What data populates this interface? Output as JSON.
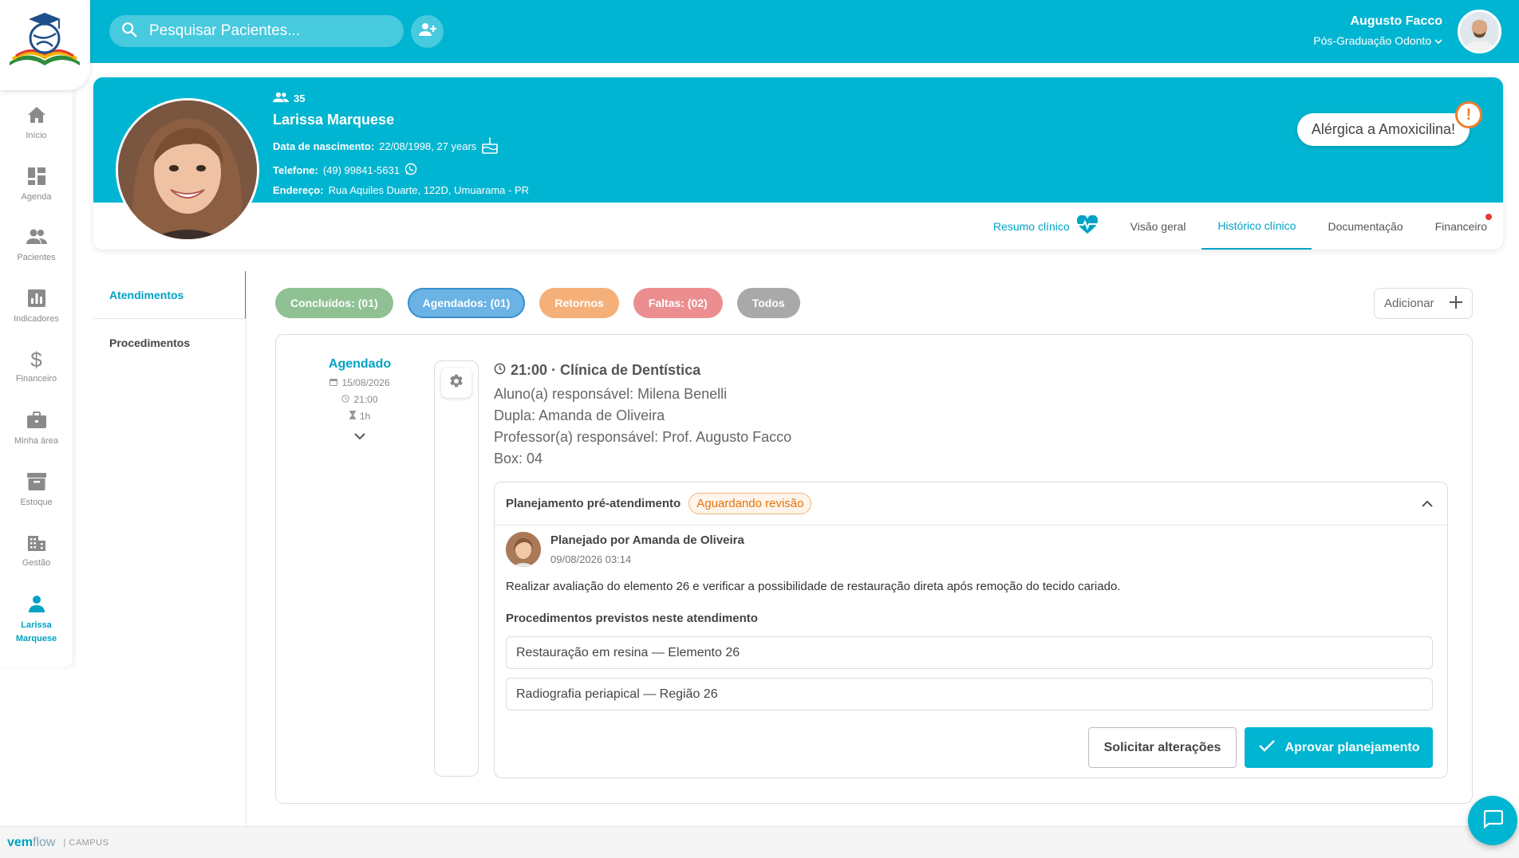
{
  "header": {
    "search_placeholder": "Pesquisar Pacientes...",
    "user_name": "Augusto Facco",
    "user_role": "Pós-Graduação Odonto"
  },
  "sidebar": {
    "items": [
      {
        "label": "Início"
      },
      {
        "label": "Agenda"
      },
      {
        "label": "Pacientes"
      },
      {
        "label": "Indicadores"
      },
      {
        "label": "Financeiro"
      },
      {
        "label": "Minha área"
      },
      {
        "label": "Estoque"
      },
      {
        "label": "Gestão"
      },
      {
        "label": "Larissa Marquese"
      }
    ]
  },
  "patient": {
    "count": "35",
    "name": "Larissa Marquese",
    "birth_label": "Data de nascimento:",
    "birth_value": "22/08/1998, 27 years",
    "phone_label": "Telefone:",
    "phone_value": "(49) 99841-5631",
    "address_label": "Endereço:",
    "address_value": "Rua Aquiles Duarte, 122D, Umuarama - PR",
    "allergy": "Alérgica a Amoxicilina!",
    "allergy_mark": "!"
  },
  "tabs": [
    {
      "label": "Resumo clínico"
    },
    {
      "label": "Visão geral"
    },
    {
      "label": "Histórico clínico"
    },
    {
      "label": "Documentação"
    },
    {
      "label": "Financeiro"
    }
  ],
  "subnav": [
    {
      "label": "Atendimentos"
    },
    {
      "label": "Procedimentos"
    }
  ],
  "filters": [
    {
      "label": "Concluídos: (01)"
    },
    {
      "label": "Agendados: (01)"
    },
    {
      "label": "Retornos"
    },
    {
      "label": "Faltas: (02)"
    },
    {
      "label": "Todos"
    }
  ],
  "add_label": "Adicionar",
  "appointment": {
    "status": "Agendado",
    "date": "15/08/2026",
    "time": "21:00",
    "duration": "1h",
    "title": "21:00 · Clínica de Dentística",
    "student": "Aluno(a) responsável: Milena Benelli",
    "pair": "Dupla: Amanda de Oliveira",
    "professor": "Professor(a) responsável: Prof. Augusto Facco",
    "box": "Box: 04"
  },
  "planning": {
    "title": "Planejamento pré-atendimento",
    "badge": "Aguardando revisão",
    "planner": "Planejado por Amanda de Oliveira",
    "planned_at": "09/08/2026 03:14",
    "description": "Realizar avaliação do elemento 26 e verificar a possibilidade de restauração direta após remoção do tecido cariado.",
    "procedures_title": "Procedimentos previstos neste atendimento",
    "procedures": [
      "Restauração em resina — Elemento 26",
      "Radiografia periapical — Região 26"
    ],
    "request_label": "Solicitar alterações",
    "approve_label": "Aprovar planejamento"
  },
  "footer": {
    "brand_a": "vem",
    "brand_b": "flow",
    "brand_c": "| CAMPUS"
  },
  "colors": {
    "primary": "#00b5d1",
    "accent_text": "#00a3c4",
    "warning": "#f07f2e",
    "done": "#8fc193",
    "scheduled": "#6bb3e4",
    "return": "#f5b07a",
    "absence": "#ec8e90",
    "all": "#a9a9a9"
  }
}
